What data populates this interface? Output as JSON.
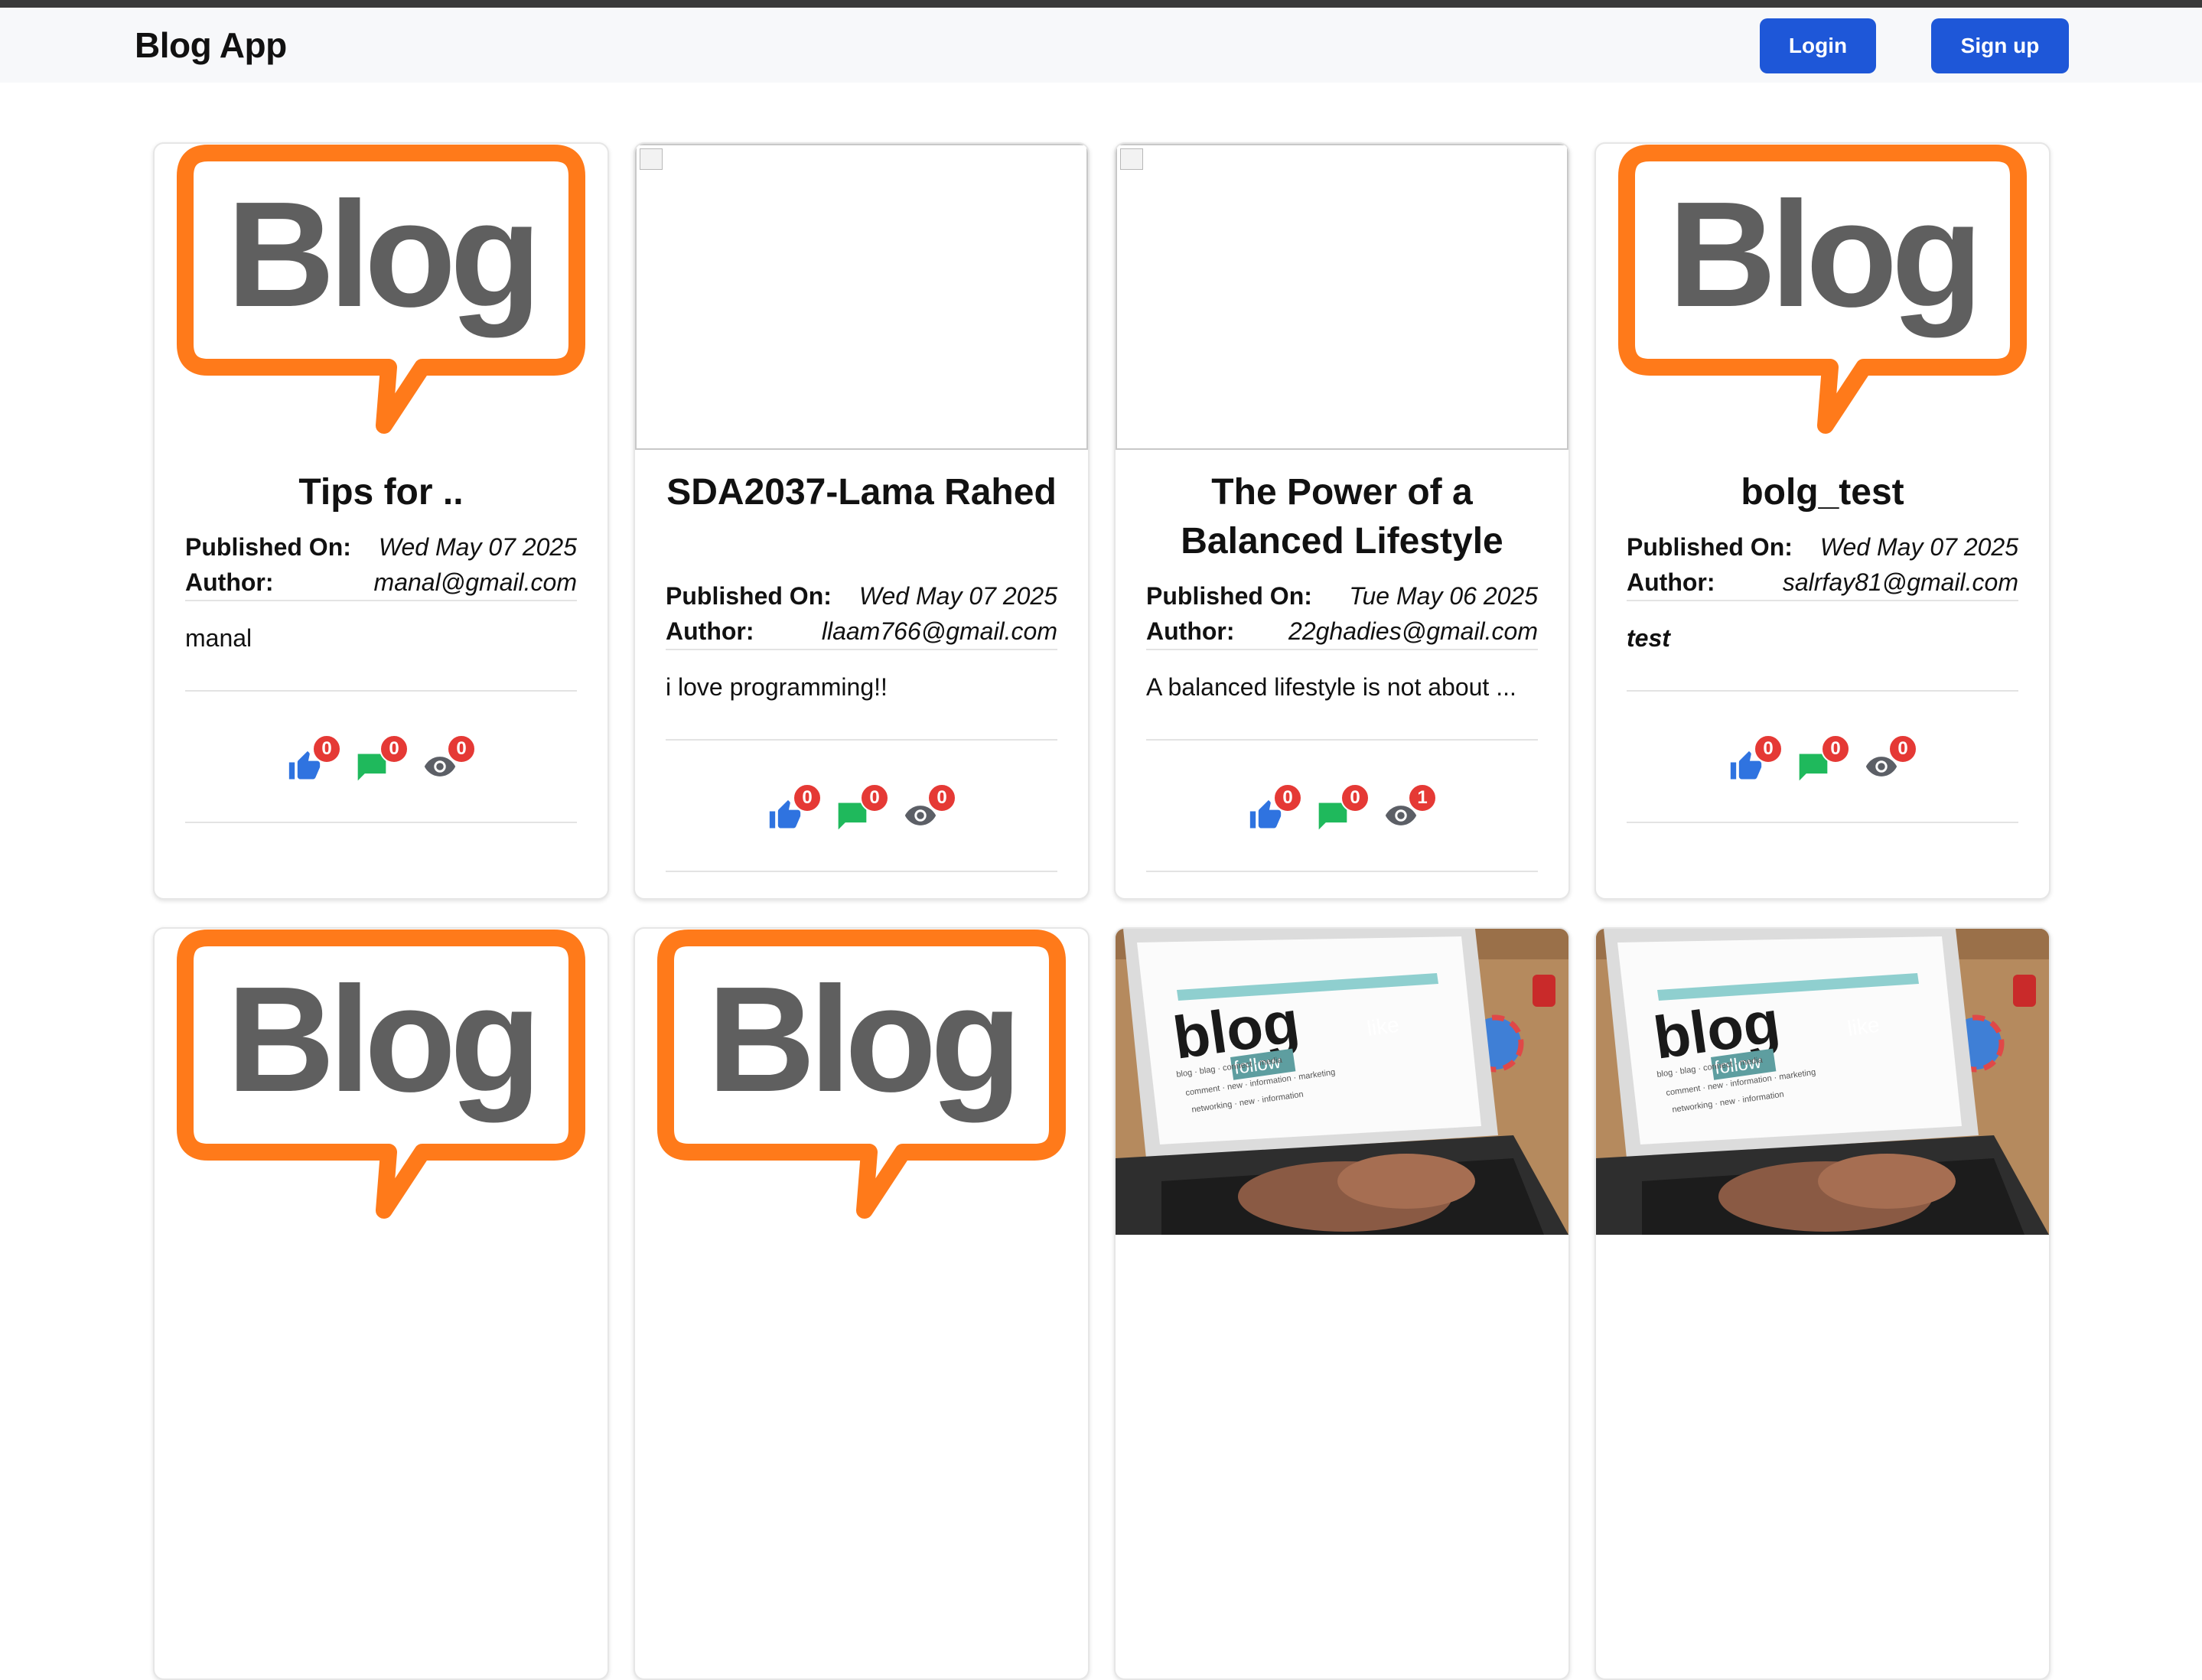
{
  "navbar": {
    "brand": "Blog App",
    "login_label": "Login",
    "signup_label": "Sign up"
  },
  "labels": {
    "published_on": "Published On:",
    "author": "Author:"
  },
  "logo_text": "Blog",
  "colors": {
    "primary_button": "#1e57d8",
    "logo_orange": "#ff7a1a",
    "logo_gray": "#5f5f5f",
    "like_icon": "#2f73e0",
    "comment_icon": "#1fb95c",
    "view_icon": "#5c5f66",
    "badge": "#e53935"
  },
  "posts": [
    {
      "title": "Tips for ..",
      "image": "blog-logo",
      "published": "Wed May 07 2025",
      "author": "manal@gmail.com",
      "description": "manal",
      "likes": "0",
      "comments": "0",
      "views": "0"
    },
    {
      "title": "SDA2037-Lama Rahed",
      "image": "broken-image",
      "published": "Wed May 07 2025",
      "author": "llaam766@gmail.com",
      "description": "i love programming!!",
      "likes": "0",
      "comments": "0",
      "views": "0"
    },
    {
      "title": "The Power of a Balanced Lifestyle",
      "image": "broken-image",
      "published": "Tue May 06 2025",
      "author": "22ghadies@gmail.com",
      "description": "A balanced lifestyle is not about ...",
      "likes": "0",
      "comments": "0",
      "views": "1"
    },
    {
      "title": "bolg_test",
      "image": "blog-logo",
      "published": "Wed May 07 2025",
      "author": "salrfay81@gmail.com",
      "description": "test",
      "likes": "0",
      "comments": "0",
      "views": "0"
    },
    {
      "image": "blog-logo"
    },
    {
      "image": "blog-logo"
    },
    {
      "image": "laptop-photo",
      "photo_text": {
        "main": "blog",
        "follow": "follow",
        "like": "like",
        "line1": "blog · blag · connect · media",
        "line2": "comment · new · information · marketing",
        "line3": "networking · new · information"
      }
    },
    {
      "image": "laptop-photo",
      "photo_text": {
        "main": "blog",
        "follow": "follow",
        "like": "like",
        "line1": "blog · blag · connect · media",
        "line2": "comment · new · information · marketing",
        "line3": "networking · new · information"
      }
    }
  ]
}
